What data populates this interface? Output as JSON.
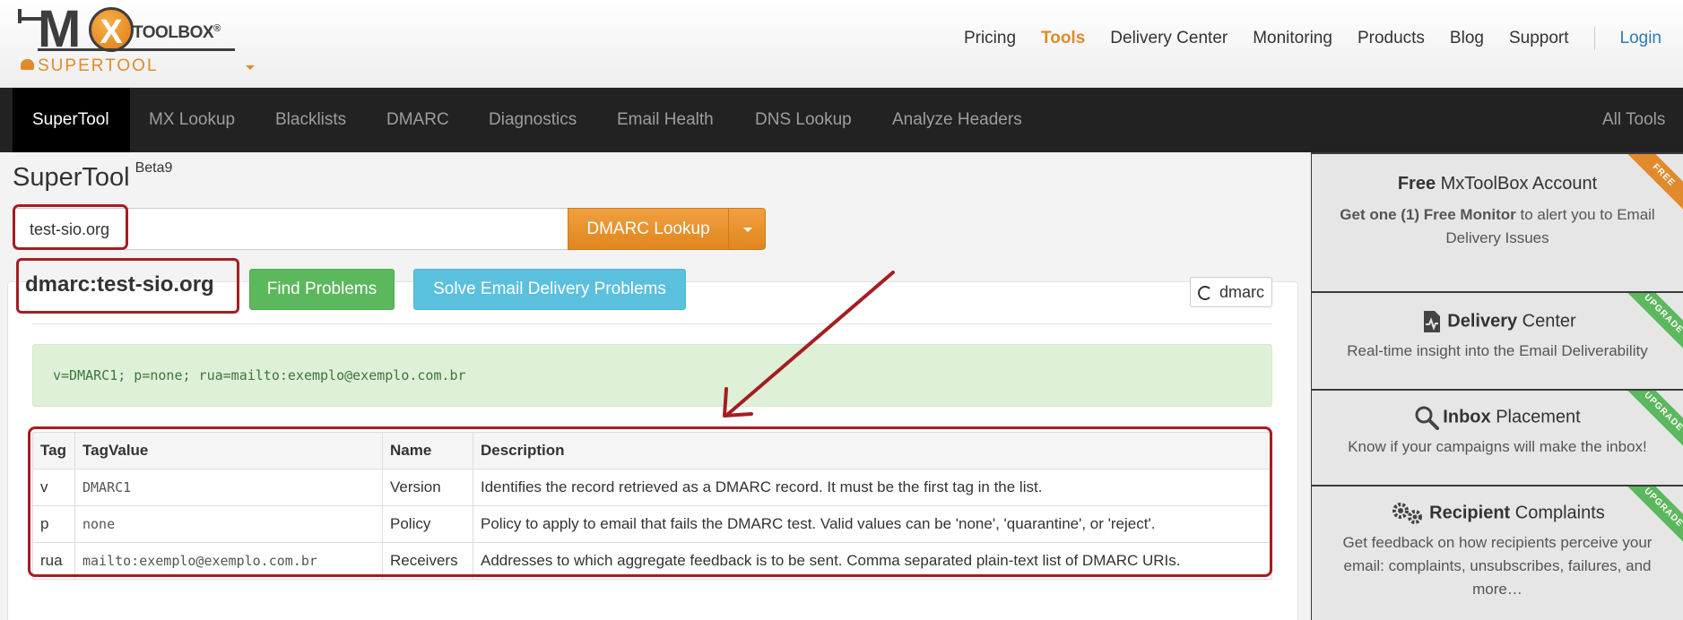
{
  "brand": {
    "logo_mx": "M",
    "logo_x": "X",
    "logo_toolbox": "TOOLBOX",
    "logo_reg": "®",
    "product": "SUPERTOOL"
  },
  "topnav": {
    "items": [
      "Pricing",
      "Tools",
      "Delivery Center",
      "Monitoring",
      "Products",
      "Blog",
      "Support"
    ],
    "active": "Tools",
    "login": "Login"
  },
  "tabs": {
    "items": [
      "SuperTool",
      "MX Lookup",
      "Blacklists",
      "DMARC",
      "Diagnostics",
      "Email Health",
      "DNS Lookup",
      "Analyze Headers"
    ],
    "active": "SuperTool",
    "all_tools": "All Tools"
  },
  "page": {
    "title": "SuperTool",
    "title_badge": "Beta9"
  },
  "search": {
    "value": "test-sio.org",
    "lookup_label": "DMARC Lookup"
  },
  "result": {
    "title": "dmarc:test-sio.org",
    "find_problems": "Find Problems",
    "solve_problems": "Solve Email Delivery Problems",
    "refresh_label": "dmarc",
    "record": "v=DMARC1; p=none; rua=mailto:exemplo@exemplo.com.br"
  },
  "table": {
    "headers": [
      "Tag",
      "TagValue",
      "Name",
      "Description"
    ],
    "rows": [
      {
        "tag": "v",
        "value": "DMARC1",
        "name": "Version",
        "description": "Identifies the record retrieved as a DMARC record. It must be the first tag in the list."
      },
      {
        "tag": "p",
        "value": "none",
        "name": "Policy",
        "description": "Policy to apply to email that fails the DMARC test. Valid values can be 'none', 'quarantine', or 'reject'."
      },
      {
        "tag": "rua",
        "value": "mailto:exemplo@exemplo.com.br",
        "name": "Receivers",
        "description": "Addresses to which aggregate feedback is to be sent. Comma separated plain-text list of DMARC URIs."
      }
    ]
  },
  "sidebar": {
    "cards": [
      {
        "title_bold": "Free",
        "title_rest": " MxToolBox Account",
        "desc_bold": "Get one (1) Free Monitor",
        "desc_rest": " to alert you to Email Delivery Issues",
        "ribbon": "FREE",
        "ribbon_color": "#e08a2c",
        "icon": ""
      },
      {
        "title_bold": "Delivery",
        "title_rest": " Center",
        "desc_bold": "",
        "desc_rest": "Real-time insight into the Email Deliverability",
        "ribbon": "UPGRADE",
        "ribbon_color": "#5cb85c",
        "icon": "document-pulse-icon"
      },
      {
        "title_bold": "Inbox",
        "title_rest": " Placement",
        "desc_bold": "",
        "desc_rest": "Know if your campaigns will make the inbox!",
        "ribbon": "UPGRADE",
        "ribbon_color": "#5cb85c",
        "icon": "magnifier-icon"
      },
      {
        "title_bold": "Recipient",
        "title_rest": " Complaints",
        "desc_bold": "",
        "desc_rest": "Get feedback on how recipients perceive your email: complaints, unsubscribes, failures, and more…",
        "ribbon": "UPGRADE",
        "ribbon_color": "#5cb85c",
        "icon": "gears-icon"
      }
    ]
  },
  "colors": {
    "accent_orange": "#e08a2c",
    "highlight_red": "#a41e22",
    "success_green": "#5cb85c",
    "info_blue": "#5bc0de",
    "dark_nav": "#222222"
  }
}
